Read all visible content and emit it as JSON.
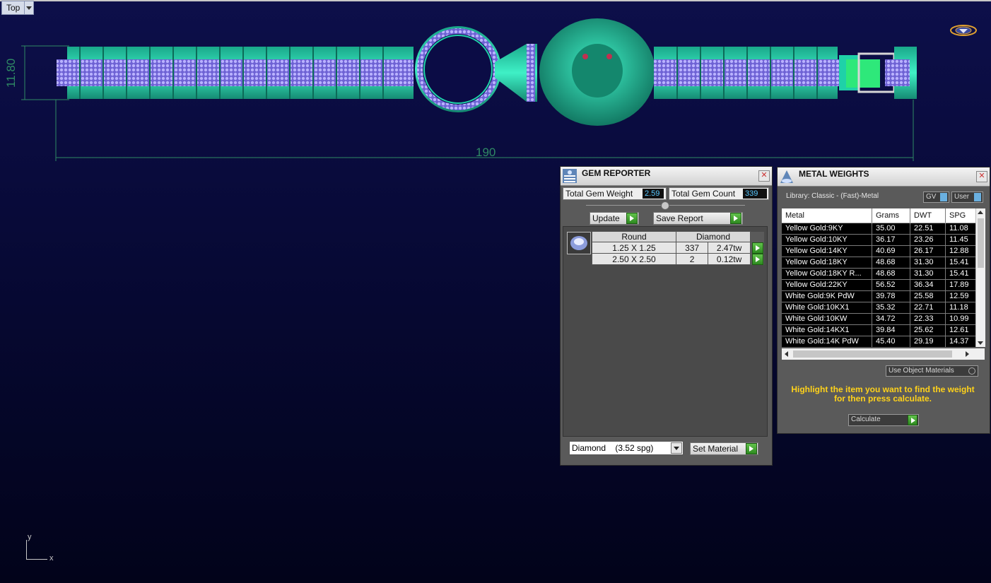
{
  "viewport": {
    "name": "Top",
    "dim_height": "11.80",
    "dim_length": "190",
    "axis_x": "x",
    "axis_y": "y"
  },
  "gem_reporter": {
    "title": "GEM REPORTER",
    "total_weight_label": "Total Gem Weight",
    "total_weight_value": "2.59",
    "total_count_label": "Total Gem Count",
    "total_count_value": "339",
    "update_label": "Update",
    "save_report_label": "Save Report",
    "table_headers": [
      "Round",
      "Diamond"
    ],
    "rows": [
      {
        "size": "1.25 X 1.25",
        "count": "337",
        "weight": "2.47tw"
      },
      {
        "size": "2.50 X 2.50",
        "count": "2",
        "weight": "0.12tw"
      }
    ],
    "material_select": "Diamond    (3.52 spg)",
    "set_material_label": "Set Material"
  },
  "metal_weights": {
    "title": "METAL WEIGHTS",
    "library_label": "Library: Classic - (Fast)-Metal",
    "gv_label": "GV",
    "user_label": "User",
    "columns": [
      "Metal",
      "Grams",
      "DWT",
      "SPG"
    ],
    "rows": [
      [
        "Yellow Gold:9KY",
        "35.00",
        "22.51",
        "11.08"
      ],
      [
        "Yellow Gold:10KY",
        "36.17",
        "23.26",
        "11.45"
      ],
      [
        "Yellow Gold:14KY",
        "40.69",
        "26.17",
        "12.88"
      ],
      [
        "Yellow Gold:18KY",
        "48.68",
        "31.30",
        "15.41"
      ],
      [
        "Yellow Gold:18KY R...",
        "48.68",
        "31.30",
        "15.41"
      ],
      [
        "Yellow Gold:22KY",
        "56.52",
        "36.34",
        "17.89"
      ],
      [
        "White Gold:9K PdW",
        "39.78",
        "25.58",
        "12.59"
      ],
      [
        "White Gold:10KX1",
        "35.32",
        "22.71",
        "11.18"
      ],
      [
        "White Gold:10KW",
        "34.72",
        "22.33",
        "10.99"
      ],
      [
        "White Gold:14KX1",
        "39.84",
        "25.62",
        "12.61"
      ],
      [
        "White Gold:14K PdW",
        "45.40",
        "29.19",
        "14.37"
      ]
    ],
    "use_object_materials_label": "Use Object Materials",
    "hint_text": "Highlight the item you want to find the weight for then press calculate.",
    "calculate_label": "Calculate"
  },
  "colors": {
    "metal": "#1fd1a8",
    "gem": "#8a7ae8",
    "dim_line": "#2f8a64",
    "hint": "#ffd21a"
  }
}
